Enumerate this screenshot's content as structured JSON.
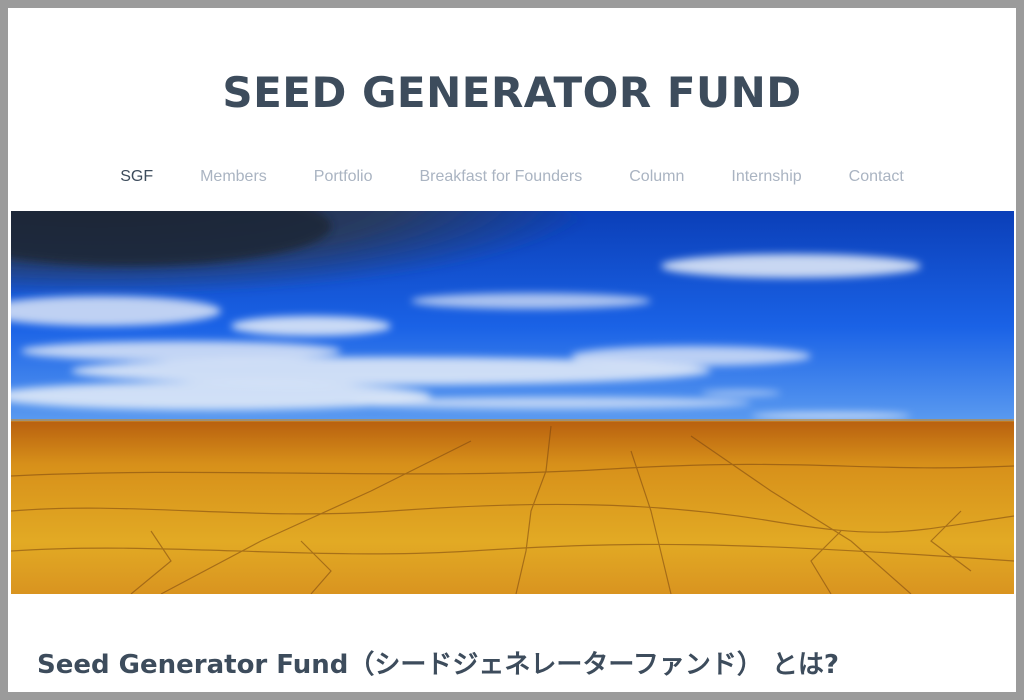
{
  "site": {
    "title": "SEED GENERATOR FUND"
  },
  "nav": {
    "items": [
      {
        "label": "SGF",
        "active": true
      },
      {
        "label": "Members",
        "active": false
      },
      {
        "label": "Portfolio",
        "active": false
      },
      {
        "label": "Breakfast for Founders",
        "active": false
      },
      {
        "label": "Column",
        "active": false
      },
      {
        "label": "Internship",
        "active": false
      },
      {
        "label": "Contact",
        "active": false
      }
    ]
  },
  "hero": {
    "image": "desert-landscape-blue-sky"
  },
  "content": {
    "heading": "Seed Generator Fund（シードジェネレーターファンド） とは?"
  },
  "colors": {
    "title": "#3d4c5c",
    "nav_inactive": "#aab4c2",
    "nav_active": "#3d4c5c",
    "sky": "#1a5fe0",
    "ground": "#d99a1c"
  }
}
